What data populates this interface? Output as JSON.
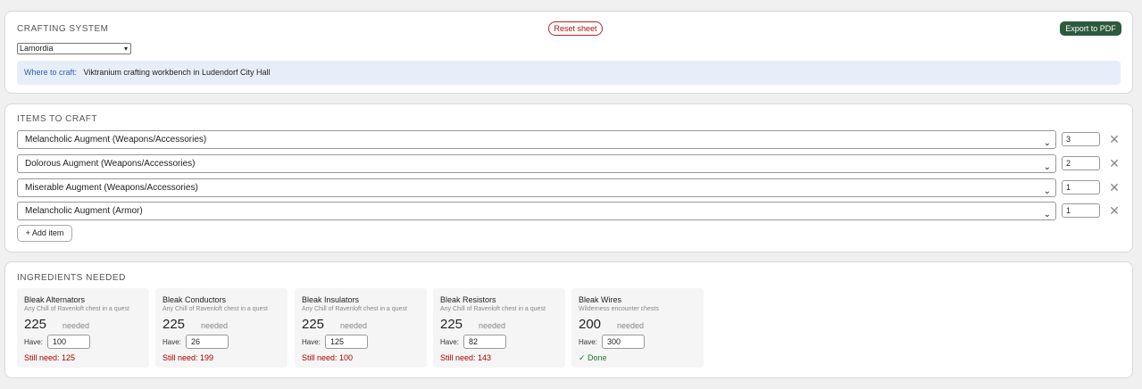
{
  "system": {
    "title": "CRAFTING SYSTEM",
    "reset_label": "Reset sheet",
    "export_label": "Export to PDF",
    "selected": "Lamordia",
    "where_label": "Where to craft:",
    "where_value": "Viktranium crafting workbench in Ludendorf City Hall"
  },
  "items": {
    "title": "ITEMS TO CRAFT",
    "rows": [
      {
        "name": "Melancholic Augment (Weapons/Accessories)",
        "qty": "3"
      },
      {
        "name": "Dolorous Augment (Weapons/Accessories)",
        "qty": "2"
      },
      {
        "name": "Miserable Augment (Weapons/Accessories)",
        "qty": "1"
      },
      {
        "name": "Melancholic Augment (Armor)",
        "qty": "1"
      }
    ],
    "remove_glyph": "✕",
    "add_label": "+ Add item"
  },
  "ingredients": {
    "title": "INGREDIENTS NEEDED",
    "needed_label": "needed",
    "have_label": "Have:",
    "cards": [
      {
        "name": "Bleak Alternators",
        "source": "Any Chill of Ravenloft chest in a quest",
        "needed": "225",
        "have": "100",
        "status": "Still need: 125",
        "done": false
      },
      {
        "name": "Bleak Conductors",
        "source": "Any Chill of Ravenloft chest in a quest",
        "needed": "225",
        "have": "26",
        "status": "Still need: 199",
        "done": false
      },
      {
        "name": "Bleak Insulators",
        "source": "Any Chill of Ravenloft chest in a quest",
        "needed": "225",
        "have": "125",
        "status": "Still need: 100",
        "done": false
      },
      {
        "name": "Bleak Resistors",
        "source": "Any Chill of Ravenloft chest in a quest",
        "needed": "225",
        "have": "82",
        "status": "Still need: 143",
        "done": false
      },
      {
        "name": "Bleak Wires",
        "source": "Wilderness encounter chests",
        "needed": "200",
        "have": "300",
        "status": "✓ Done",
        "done": true
      }
    ]
  },
  "colors": {
    "accent_red": "#a00000",
    "export_green": "#2d5a3d",
    "done_green": "#1a7a2a",
    "info_bg": "#e6eefa"
  }
}
